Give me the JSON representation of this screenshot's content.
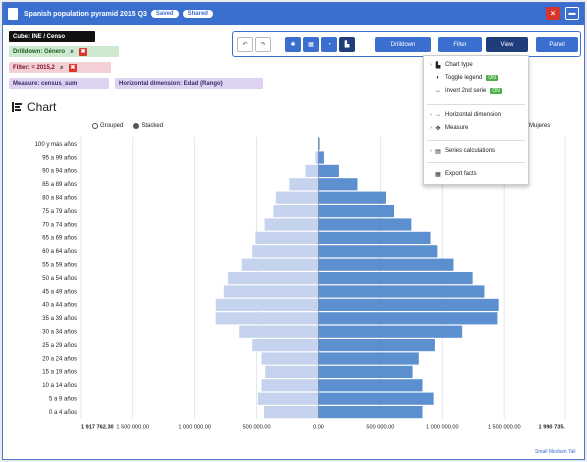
{
  "window": {
    "title": "Spanish population pyramid 2015 Q3",
    "badges": [
      "Saved",
      "Shared"
    ],
    "close_glyph": "×",
    "minimize_glyph": "▬"
  },
  "tags": {
    "cube": "Cube: INE / Censo",
    "drilldown": "Drilldown: Género",
    "filter": "Filter: = 2015,2",
    "measure": "Measure: census_sum",
    "horizontal_dimension": "Horizontal dimension: Edad (Rango)"
  },
  "toolbar": {
    "undo": "↶",
    "redo": "↷",
    "drilldown_label": "Drilldown",
    "filter_label": "Filter",
    "view_label": "View",
    "panel_label": "Panel"
  },
  "view_menu": {
    "chart_type": "Chart type",
    "toggle_legend": "Toggle legend",
    "invert_2nd_serie": "Invert 2nd serie",
    "on_badge": "ON",
    "horizontal_dimension": "Horizontal dimension",
    "measure": "Measure",
    "series_calculations": "Series calculations",
    "export_facts": "Export facts"
  },
  "chart": {
    "heading": "Chart",
    "grouped_label": "Grouped",
    "stacked_label": "Stacked",
    "legend_right": "Mujeres",
    "footer_note": "Small Medium Tall"
  },
  "colors": {
    "accent": "#3a6fd0",
    "male_bar": "#c5d3ef",
    "female_bar": "#5b8fcf"
  },
  "chart_data": {
    "type": "bar",
    "orientation": "horizontal",
    "categories": [
      "100 y más años",
      "95 a 99 años",
      "90 a 94 años",
      "85 a 89 años",
      "80 a 84 años",
      "75 a 79 años",
      "70 a 74 años",
      "65 a 69 años",
      "60 a 64 años",
      "55 a 59 años",
      "50 a 54 años",
      "45 a 49 años",
      "40 a 44 años",
      "35 a 39 años",
      "30 a 34 años",
      "25 a 29 años",
      "20 a 24 años",
      "15 a 19 años",
      "10 a 14 años",
      "5 a 9 años",
      "0 a 4 años"
    ],
    "series": [
      {
        "values": [
          -3000,
          -25000,
          -105000,
          -235000,
          -345000,
          -365000,
          -435000,
          -510000,
          -535000,
          -620000,
          -730000,
          -765000,
          -830000,
          -830000,
          -640000,
          -535000,
          -460000,
          -430000,
          -460000,
          -490000,
          -440000
        ]
      },
      {
        "values": [
          9000,
          44000,
          165000,
          315000,
          545000,
          610000,
          750000,
          905000,
          960000,
          1090000,
          1245000,
          1340000,
          1455000,
          1445000,
          1160000,
          940000,
          810000,
          760000,
          840000,
          930000,
          840000
        ]
      }
    ],
    "xlim": [
      -1917762.3,
      1990735
    ],
    "xticks": [
      "1 917 762.30",
      "1 500 000.00",
      "1 000 000.00",
      "500 000.00",
      "0.00",
      "500 000.00",
      "1 000 000.00",
      "1 500 000.00",
      "1 990 735."
    ],
    "xtick_values": [
      -1917762.3,
      -1500000,
      -1000000,
      -500000,
      0,
      500000,
      1000000,
      1500000,
      1990735
    ],
    "grid": true
  }
}
